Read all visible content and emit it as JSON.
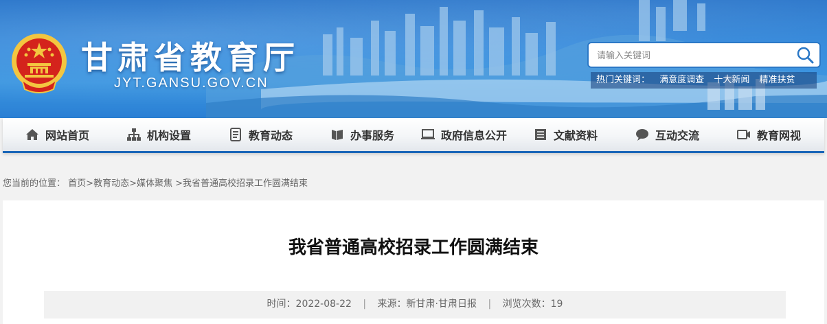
{
  "header": {
    "title": "甘肃省教育厅",
    "domain": "JYT.GANSU.GOV.CN",
    "emblem_icon": "national-emblem-icon",
    "search": {
      "placeholder": "请输入关键词",
      "icon": "search-icon"
    },
    "hot_keywords": {
      "label": "热门关键词：",
      "items": [
        "满意度调查",
        "十大新闻",
        "精准扶贫"
      ]
    }
  },
  "nav": {
    "items": [
      {
        "label": "网站首页",
        "icon": "home-icon"
      },
      {
        "label": "机构设置",
        "icon": "org-chart-icon"
      },
      {
        "label": "教育动态",
        "icon": "news-document-icon"
      },
      {
        "label": "办事服务",
        "icon": "service-icon"
      },
      {
        "label": "政府信息公开",
        "icon": "monitor-icon"
      },
      {
        "label": "文献资料",
        "icon": "archive-icon"
      },
      {
        "label": "互动交流",
        "icon": "chat-icon"
      },
      {
        "label": "教育网视",
        "icon": "video-camera-icon"
      }
    ]
  },
  "breadcrumb": {
    "prefix": "您当前的位置：",
    "items": [
      "首页",
      "教育动态",
      "媒体聚焦",
      "我省普通高校招录工作圆满结束"
    ]
  },
  "article": {
    "title": "我省普通高校招录工作圆满结束",
    "meta": {
      "time_label": "时间：",
      "time": "2022-08-22",
      "source_label": "来源：",
      "source": "新甘肃·甘肃日报",
      "views_label": "浏览次数：",
      "views": "19"
    }
  },
  "colors": {
    "brand_blue": "#1a66b8",
    "emblem_red": "#d4231c",
    "emblem_gold": "#f3c640"
  }
}
